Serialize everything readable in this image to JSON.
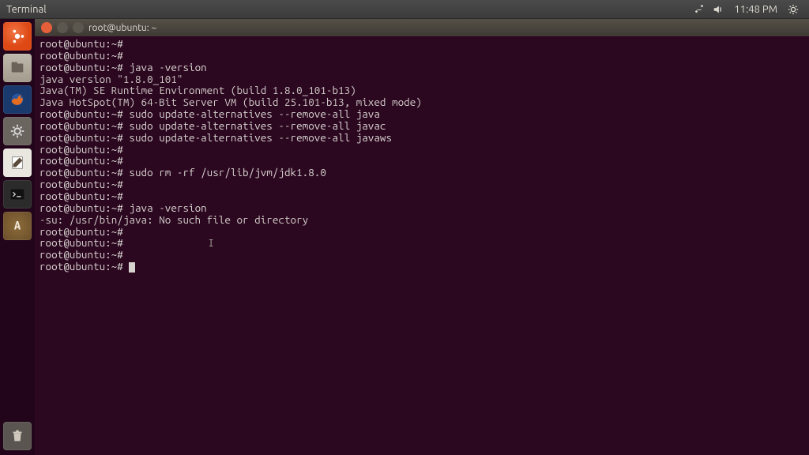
{
  "menubar": {
    "title": "Terminal",
    "clock": "11:48 PM"
  },
  "launcher": {
    "items": [
      {
        "name": "dash"
      },
      {
        "name": "files"
      },
      {
        "name": "firefox"
      },
      {
        "name": "settings"
      },
      {
        "name": "text-editor"
      },
      {
        "name": "terminal"
      },
      {
        "name": "software-updater"
      }
    ],
    "trash": "trash"
  },
  "window": {
    "title": "root@ubuntu: ~"
  },
  "terminal": {
    "prompt": "root@ubuntu:~#",
    "lines": [
      {
        "type": "prompt",
        "cmd": ""
      },
      {
        "type": "prompt",
        "cmd": ""
      },
      {
        "type": "prompt",
        "cmd": "java -version"
      },
      {
        "type": "out",
        "text": "java version \"1.8.0_101\""
      },
      {
        "type": "out",
        "text": "Java(TM) SE Runtime Environment (build 1.8.0_101-b13)"
      },
      {
        "type": "out",
        "text": "Java HotSpot(TM) 64-Bit Server VM (build 25.101-b13, mixed mode)"
      },
      {
        "type": "prompt",
        "cmd": "sudo update-alternatives --remove-all java"
      },
      {
        "type": "prompt",
        "cmd": "sudo update-alternatives --remove-all javac"
      },
      {
        "type": "prompt",
        "cmd": "sudo update-alternatives --remove-all javaws"
      },
      {
        "type": "prompt",
        "cmd": ""
      },
      {
        "type": "prompt",
        "cmd": ""
      },
      {
        "type": "prompt",
        "cmd": "sudo rm -rf /usr/lib/jvm/jdk1.8.0"
      },
      {
        "type": "prompt",
        "cmd": ""
      },
      {
        "type": "prompt",
        "cmd": ""
      },
      {
        "type": "prompt",
        "cmd": "java -version"
      },
      {
        "type": "out",
        "text": "-su: /usr/bin/java: No such file or directory"
      },
      {
        "type": "prompt",
        "cmd": ""
      },
      {
        "type": "prompt",
        "cmd": "",
        "caret": true
      },
      {
        "type": "prompt",
        "cmd": ""
      },
      {
        "type": "prompt",
        "cmd": "",
        "cursor": true
      }
    ]
  }
}
